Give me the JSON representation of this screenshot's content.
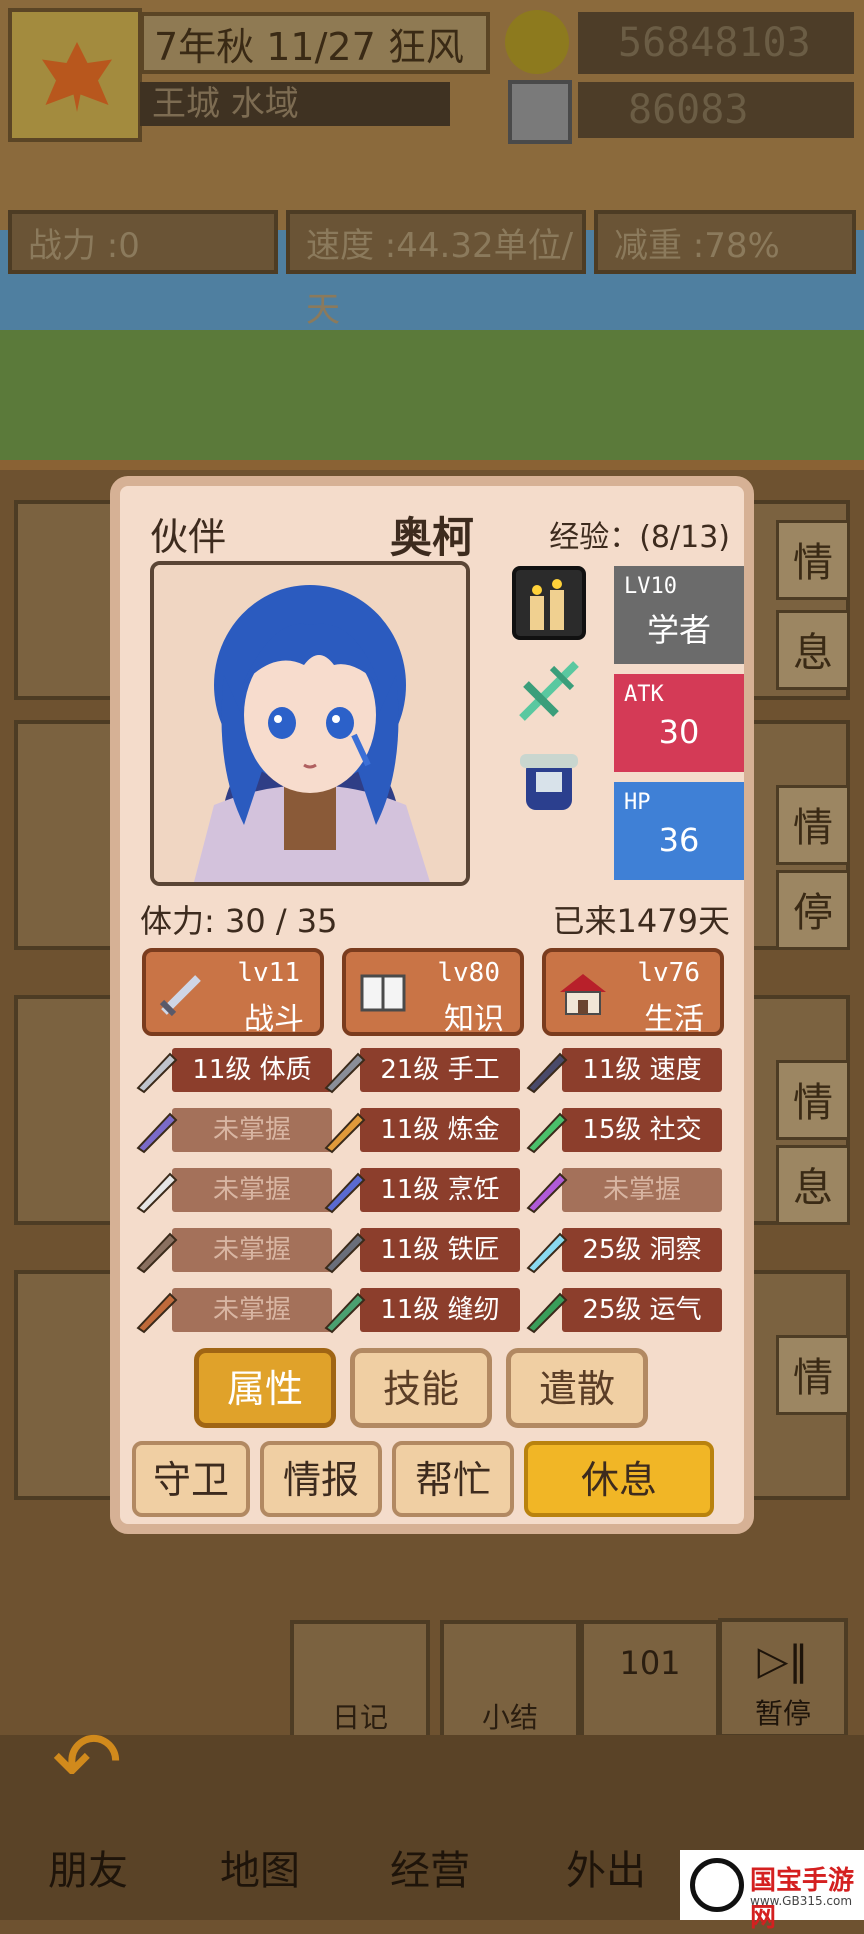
{
  "top": {
    "date": "7年秋 11/27 狂风",
    "location": "王城 水域",
    "gold": "56848103",
    "gems": "86083"
  },
  "stats": {
    "power": "战力 :0",
    "speed": "速度 :44.32单位/天",
    "weight": "减重 :78%"
  },
  "side_buttons": [
    "情",
    "息",
    "情",
    "停",
    "情",
    "息",
    "情"
  ],
  "companion": {
    "section_label": "伙伴",
    "name": "奥柯",
    "exp": "经验：(8/13)",
    "class_level": "LV10",
    "class_name": "学者",
    "atk_label": "ATK",
    "atk_value": "30",
    "hp_label": "HP",
    "hp_value": "36",
    "stamina": "体力: 30 / 35",
    "days": "已来1479天",
    "categories": [
      {
        "icon": "sword-icon",
        "level": "lv11",
        "name": "战斗"
      },
      {
        "icon": "book-icon",
        "level": "lv80",
        "name": "知识"
      },
      {
        "icon": "house-icon",
        "level": "lv76",
        "name": "生活"
      }
    ],
    "skills": [
      [
        {
          "icon": "shield-arm-icon",
          "text": "11级 体质",
          "locked": false
        },
        {
          "icon": "knife-icon",
          "text": "21级 手工",
          "locked": false
        },
        {
          "icon": "lightning-icon",
          "text": "11级 速度",
          "locked": false
        }
      ],
      [
        {
          "icon": "purple-sword-icon",
          "text": "未掌握",
          "locked": true
        },
        {
          "icon": "flask-icon",
          "text": "11级 炼金",
          "locked": false
        },
        {
          "icon": "slime-icon",
          "text": "15级 社交",
          "locked": false
        }
      ],
      [
        {
          "icon": "feather-blade-icon",
          "text": "未掌握",
          "locked": true
        },
        {
          "icon": "cooking-pot-icon",
          "text": "11级 烹饪",
          "locked": false
        },
        {
          "icon": "magic-sparkle-icon",
          "text": "未掌握",
          "locked": true
        }
      ],
      [
        {
          "icon": "bow-icon",
          "text": "未掌握",
          "locked": true
        },
        {
          "icon": "hammer-icon",
          "text": "11级 铁匠",
          "locked": false
        },
        {
          "icon": "eye-crystal-icon",
          "text": "25级 洞察",
          "locked": false
        }
      ],
      [
        {
          "icon": "staff-icon",
          "text": "未掌握",
          "locked": true
        },
        {
          "icon": "button-icon",
          "text": "11级 缝纫",
          "locked": false
        },
        {
          "icon": "clover-icon",
          "text": "25级 运气",
          "locked": false
        }
      ]
    ],
    "tabs": [
      "属性",
      "技能",
      "遣散"
    ],
    "actions": [
      "守卫",
      "情报",
      "帮忙",
      "休息"
    ]
  },
  "bottom": {
    "diary": "日记",
    "summary": "小结",
    "count": "101",
    "pause": "暂停",
    "nav": [
      "朋友",
      "地图",
      "经营",
      "外出"
    ]
  },
  "watermark": {
    "text": "国宝手游网",
    "url": "www.GB315.com"
  },
  "colors": {
    "atk": "#d43a56",
    "hp": "#3f80d6",
    "class": "#6b6b6b",
    "tab_active": "#e0a22a",
    "rest_button": "#f1b626"
  }
}
